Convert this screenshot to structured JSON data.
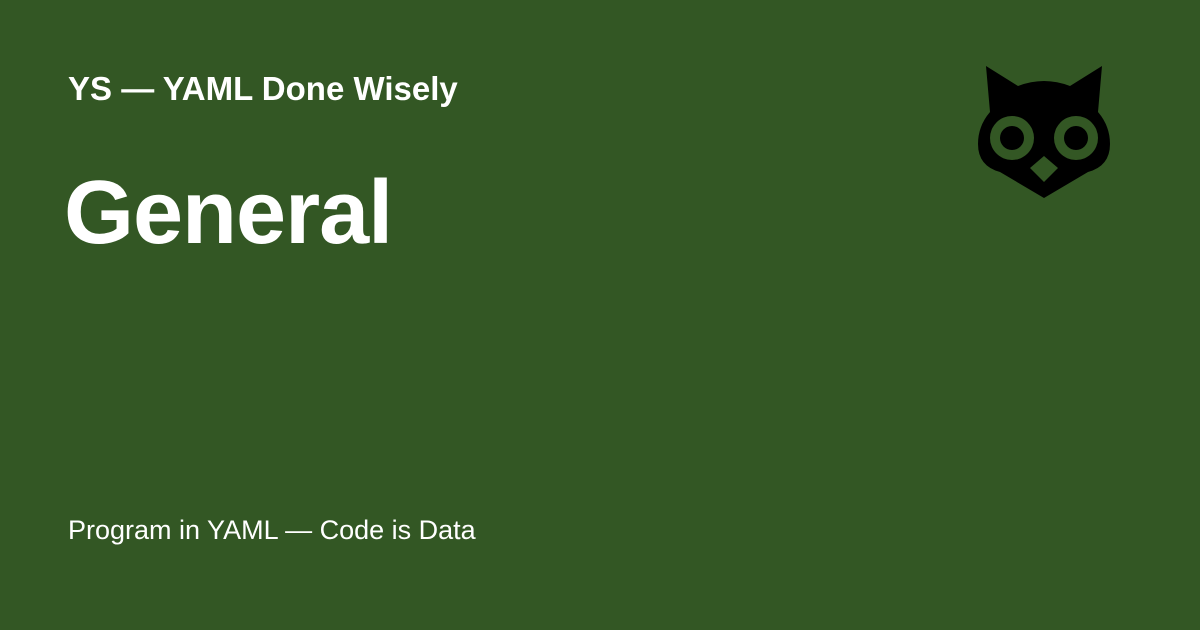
{
  "header": {
    "site_title": "YS — YAML Done Wisely",
    "logo_icon": "owl-icon"
  },
  "main": {
    "page_heading": "General"
  },
  "footer": {
    "tagline": "Program in YAML — Code is Data"
  },
  "colors": {
    "background": "#335724",
    "text": "#ffffff",
    "logo": "#000000"
  }
}
